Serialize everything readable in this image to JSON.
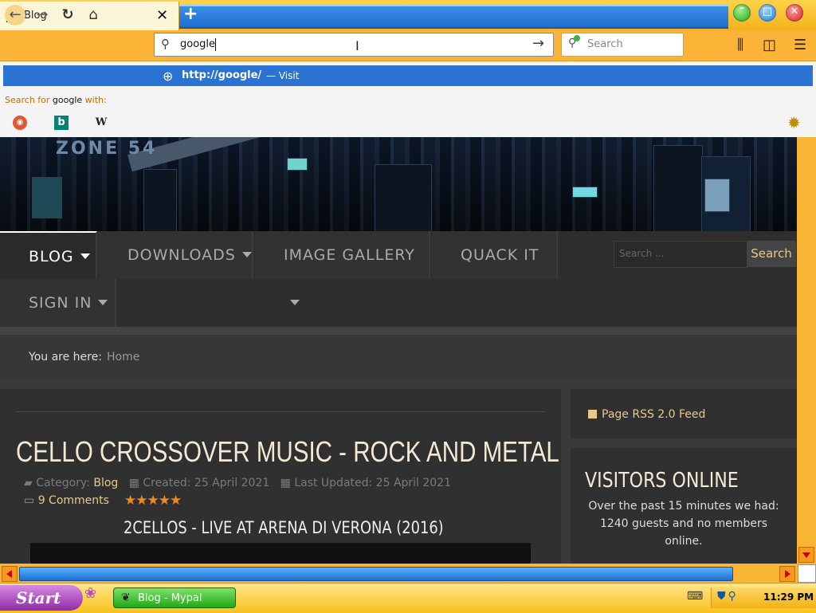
{
  "browser": {
    "tab": {
      "title": "Blog"
    },
    "newtab_label": "+",
    "window_buttons": {
      "minimize": "–",
      "maximize": "□",
      "close": "✕"
    },
    "address": {
      "value": "google"
    },
    "search": {
      "placeholder": "Search"
    },
    "suggestion": {
      "url": "http://google/",
      "separator": "—",
      "action": "Visit"
    },
    "search_with": {
      "prefix": "Search for",
      "term": "google",
      "suffix": "with:"
    },
    "engines": [
      "duckduckgo-icon",
      "bing-icon",
      "wikipedia-icon"
    ],
    "engine_glyphs": {
      "ddg": "◉",
      "bing": "b",
      "wiki": "W"
    }
  },
  "site": {
    "logo": "ZONE 54",
    "menu": {
      "blog": "BLOG",
      "downloads": "DOWNLOADS",
      "gallery": "IMAGE GALLERY",
      "quack": "QUACK IT",
      "signin": "SIGN IN"
    },
    "search": {
      "placeholder": "Search ...",
      "button": "Search"
    },
    "breadcrumb": {
      "label": "You are here:",
      "home": "Home"
    },
    "article": {
      "title": "CELLO CROSSOVER MUSIC - ROCK AND METAL",
      "category_label": "Category:",
      "category": "Blog",
      "created": "Created: 25 April 2021",
      "updated": "Last Updated: 25 April 2021",
      "comments": "9 Comments",
      "stars": "★★★★★",
      "video_title": "2CELLOS - LIVE AT ARENA DI VERONA (2016)"
    },
    "rss": "Page RSS 2.0 Feed",
    "visitors": {
      "title": "VISITORS ONLINE",
      "text": "Over the past 15 minutes we had: 1240 guests and no members online."
    }
  },
  "taskbar": {
    "start": "Start",
    "task": "Blog - Mypal",
    "clock": "11:29 PM"
  },
  "colors": {
    "accent": "#f8b634",
    "link": "#e8c98a",
    "highlight": "#2a73d2"
  }
}
